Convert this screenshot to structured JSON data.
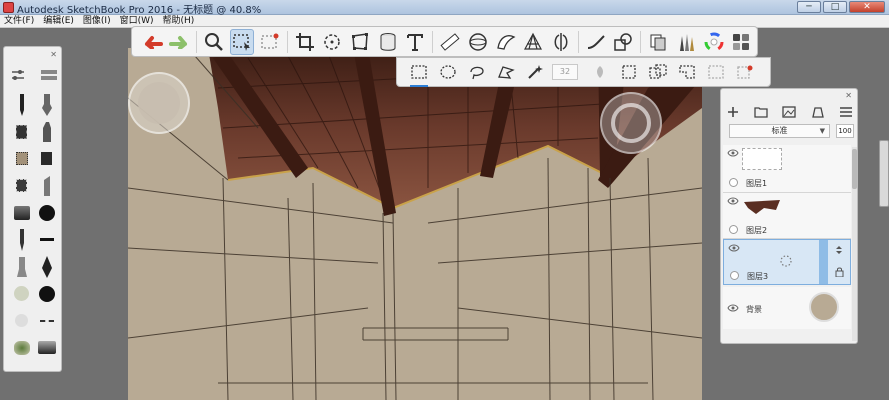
{
  "window": {
    "title": "Autodesk SketchBook Pro 2016 - 无标题 @ 40.8%",
    "minimize_label": "─",
    "maximize_label": "□",
    "close_label": "✕"
  },
  "menu": {
    "items": [
      {
        "label": "文件(F)"
      },
      {
        "label": "编辑(E)"
      },
      {
        "label": "图像(I)"
      },
      {
        "label": "窗口(W)"
      },
      {
        "label": "帮助(H)"
      }
    ]
  },
  "colors": {
    "accent": "#2d7fd6",
    "undo": "#d33b2a",
    "redo": "#8cc06a",
    "canvas": "#b8aa94",
    "ceiling": "#5a2e22"
  },
  "toolbar": {
    "icons": [
      "undo-icon",
      "redo-icon",
      "zoom-icon",
      "select-icon",
      "crop-select-icon",
      "crop-icon",
      "lasso-transform-icon",
      "distort-icon",
      "fill-bucket-icon",
      "text-icon",
      "ruler-icon",
      "ellipse-icon",
      "french-curve-icon",
      "perspective-icon",
      "symmetry-icon",
      "stroke-icon",
      "shape-icon",
      "copy-paste-icon",
      "brush-set-icon",
      "color-wheel-icon",
      "swatches-icon"
    ],
    "active": "select-icon"
  },
  "subbar": {
    "feather_value": "32",
    "active": "rect-select-icon"
  },
  "layers": {
    "blend_mode": "标准",
    "opacity": "100",
    "items": [
      {
        "name": "图层1",
        "selected": false
      },
      {
        "name": "图层2",
        "selected": false
      },
      {
        "name": "图层3",
        "selected": true
      },
      {
        "name": "背景",
        "selected": false
      }
    ]
  }
}
